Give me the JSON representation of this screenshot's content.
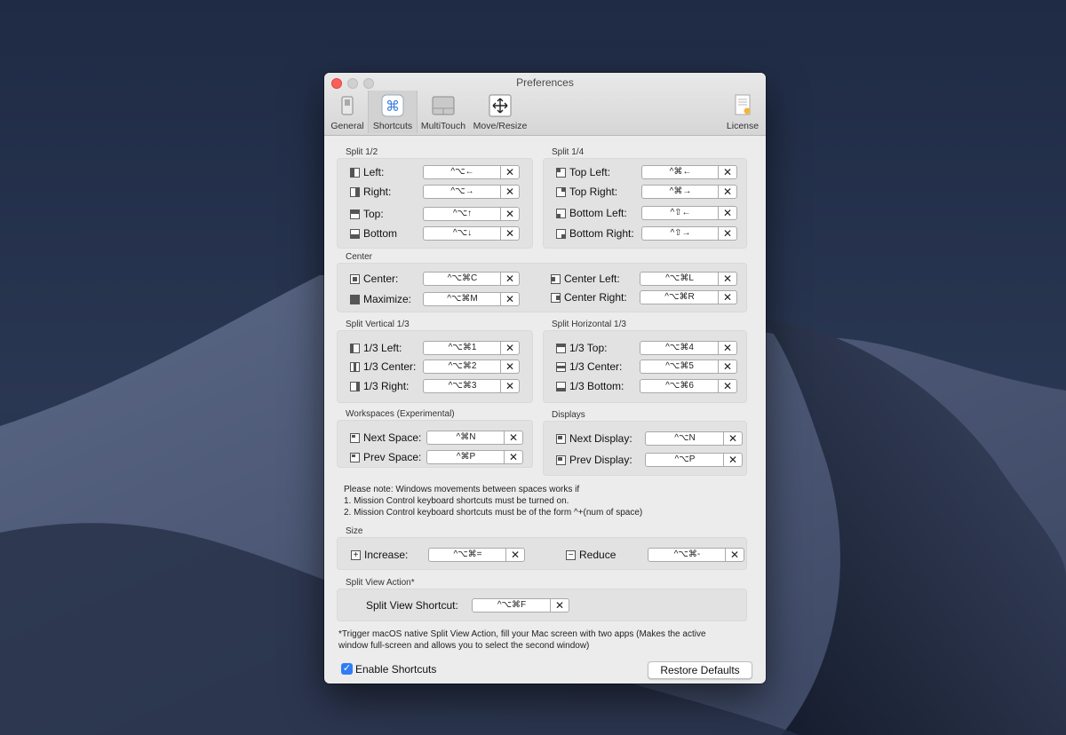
{
  "window": {
    "title": "Preferences"
  },
  "toolbar": {
    "items": [
      {
        "label": "General",
        "icon": "switch-icon"
      },
      {
        "label": "Shortcuts",
        "icon": "command-key-icon"
      },
      {
        "label": "MultiTouch",
        "icon": "trackpad-icon"
      },
      {
        "label": "Move/Resize",
        "icon": "move-arrows-icon"
      },
      {
        "label": "License",
        "icon": "certificate-icon"
      }
    ],
    "active": "Shortcuts"
  },
  "sections": {
    "split_half": {
      "title": "Split 1/2",
      "rows": [
        {
          "label": "Left:",
          "shortcut": "^⌥←"
        },
        {
          "label": "Right:",
          "shortcut": "^⌥→"
        },
        {
          "label": "Top:",
          "shortcut": "^⌥↑"
        },
        {
          "label": "Bottom",
          "shortcut": "^⌥↓"
        }
      ]
    },
    "split_quarter": {
      "title": "Split 1/4",
      "rows": [
        {
          "label": "Top Left:",
          "shortcut": "^⌘←"
        },
        {
          "label": "Top Right:",
          "shortcut": "^⌘→"
        },
        {
          "label": "Bottom Left:",
          "shortcut": "^⇧←"
        },
        {
          "label": "Bottom Right:",
          "shortcut": "^⇧→"
        }
      ]
    },
    "center": {
      "title": "Center",
      "left_rows": [
        {
          "label": "Center:",
          "shortcut": "^⌥⌘C"
        },
        {
          "label": "Maximize:",
          "shortcut": "^⌥⌘M"
        }
      ],
      "right_rows": [
        {
          "label": "Center Left:",
          "shortcut": "^⌥⌘L"
        },
        {
          "label": "Center Right:",
          "shortcut": "^⌥⌘R"
        }
      ]
    },
    "split_vertical": {
      "title": "Split Vertical 1/3",
      "rows": [
        {
          "label": "1/3 Left:",
          "shortcut": "^⌥⌘1"
        },
        {
          "label": "1/3 Center:",
          "shortcut": "^⌥⌘2"
        },
        {
          "label": "1/3 Right:",
          "shortcut": "^⌥⌘3"
        }
      ]
    },
    "split_horizontal": {
      "title": "Split Horizontal 1/3",
      "rows": [
        {
          "label": "1/3 Top:",
          "shortcut": "^⌥⌘4"
        },
        {
          "label": "1/3 Center:",
          "shortcut": "^⌥⌘5"
        },
        {
          "label": "1/3 Bottom:",
          "shortcut": "^⌥⌘6"
        }
      ]
    },
    "workspaces": {
      "title": "Workspaces (Experimental)",
      "rows": [
        {
          "label": "Next Space:",
          "shortcut": "^⌘N"
        },
        {
          "label": "Prev Space:",
          "shortcut": "^⌘P"
        }
      ]
    },
    "displays": {
      "title": "Displays",
      "rows": [
        {
          "label": "Next Display:",
          "shortcut": "^⌥N"
        },
        {
          "label": "Prev Display:",
          "shortcut": "^⌥P"
        }
      ]
    },
    "size": {
      "title": "Size",
      "rows": [
        {
          "label": "Increase:",
          "shortcut": "^⌥⌘="
        },
        {
          "label": "Reduce",
          "shortcut": "^⌥⌘-"
        }
      ]
    },
    "split_view": {
      "title": "Split View Action*",
      "rows": [
        {
          "label": "Split View Shortcut:",
          "shortcut": "^⌥⌘F"
        }
      ]
    }
  },
  "clear_glyph": "✕",
  "notes": {
    "spaces": [
      "Please note: Windows movements between spaces works if",
      "1.  Mission Control keyboard shortcuts must be turned on.",
      "2. Mission Control keyboard shortcuts must be of the form ^+(num of space)"
    ],
    "split_view": [
      "*Trigger macOS native Split View Action, fill your Mac screen with two apps (Makes the active",
      "window full-screen and allows you to select the second window)"
    ]
  },
  "footer": {
    "enable_label": "Enable Shortcuts",
    "enable_checked": true,
    "restore_label": "Restore Defaults"
  },
  "colors": {
    "accent": "#2f7cf6",
    "close": "#fc5f57",
    "window_bg": "#ececec",
    "desktop": "#1a2236"
  }
}
